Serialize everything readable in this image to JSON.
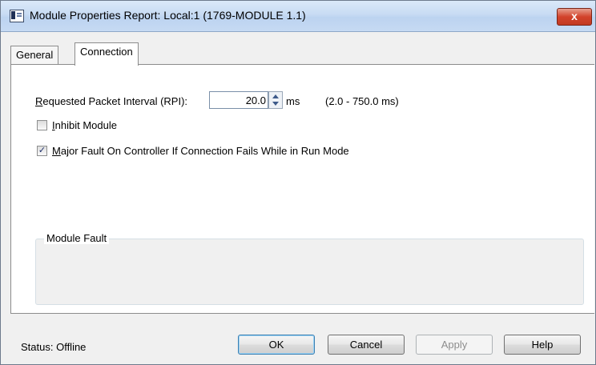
{
  "window": {
    "title": "Module Properties Report: Local:1 (1769-MODULE 1.1)",
    "close_symbol": "x"
  },
  "tabs": [
    {
      "label": "General",
      "selected": false
    },
    {
      "label": "Connection",
      "selected": true
    }
  ],
  "connection": {
    "rpi_label_prefix": "R",
    "rpi_label_rest": "equested Packet Interval (RPI):",
    "rpi_value": "20.0",
    "rpi_unit": "ms",
    "rpi_range": "(2.0 - 750.0 ms)",
    "inhibit_prefix": "I",
    "inhibit_rest": "nhibit Module",
    "inhibit_checked": false,
    "major_fault_prefix": "M",
    "major_fault_rest": "ajor Fault On Controller If Connection Fails While in Run Mode",
    "major_fault_checked": true,
    "checkmark": "✓",
    "module_fault_label": "Module Fault"
  },
  "footer": {
    "status": "Status:  Offline",
    "ok_label": "OK",
    "cancel_label": "Cancel",
    "apply_label": "Apply",
    "help_label": "Help"
  }
}
